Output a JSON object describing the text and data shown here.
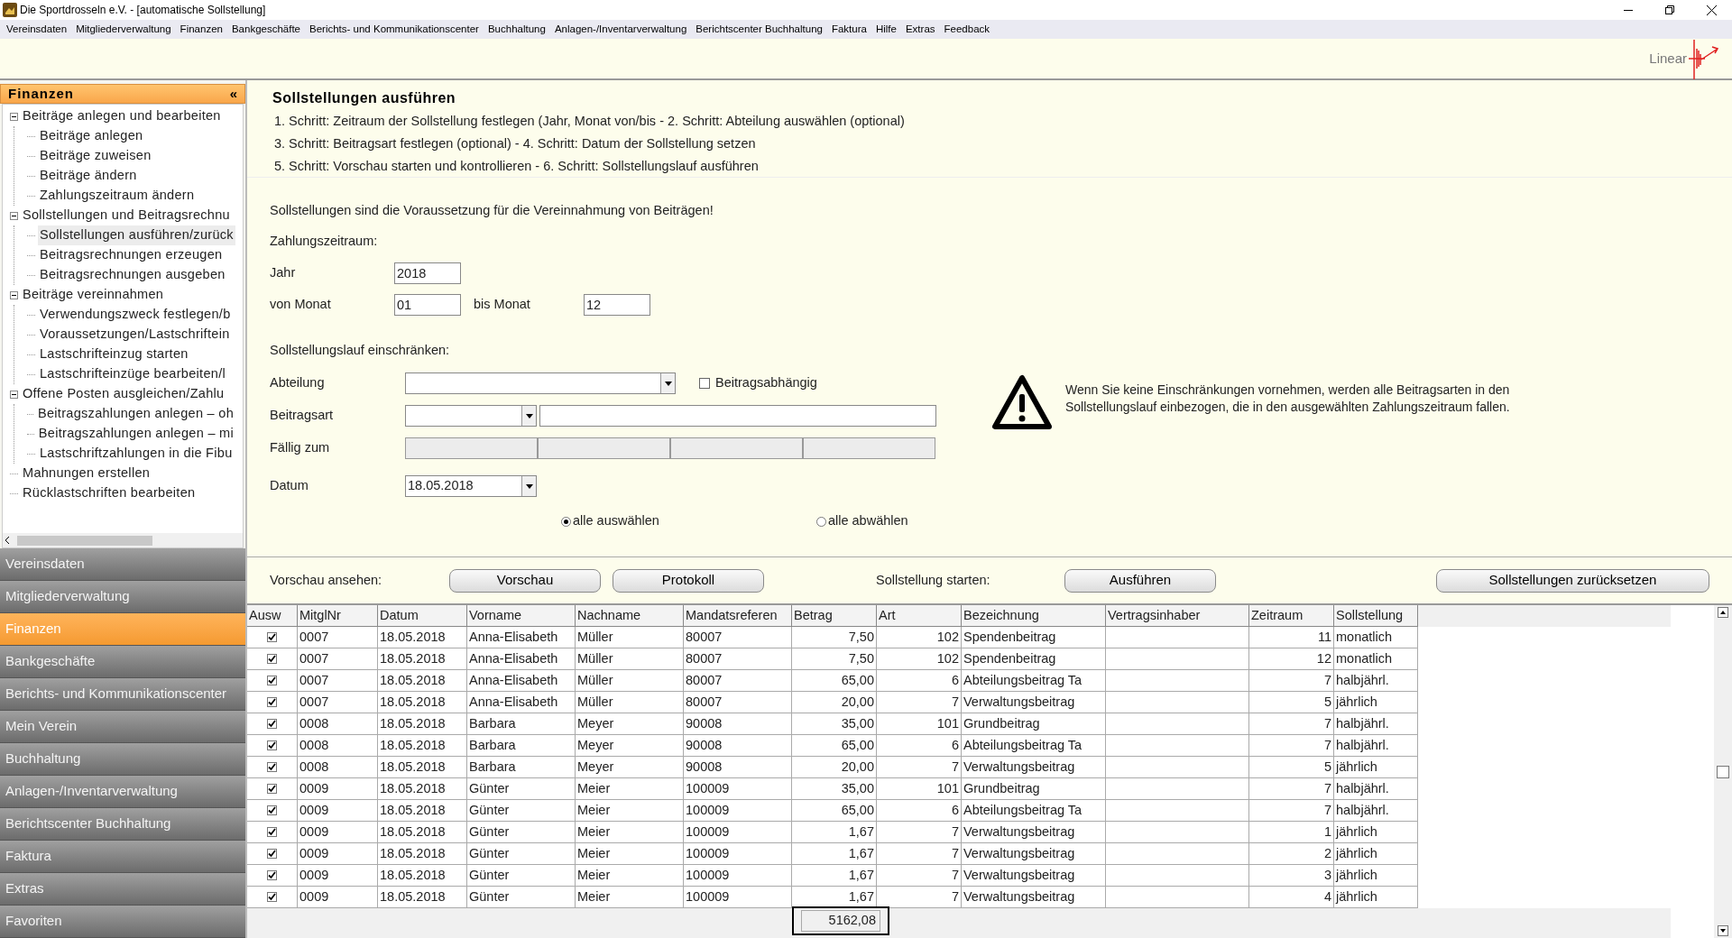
{
  "window": {
    "title": "Die Sportdrosseln e.V. - [automatische Sollstellung]"
  },
  "menu": [
    "Vereinsdaten",
    "Mitgliederverwaltung",
    "Finanzen",
    "Bankgeschäfte",
    "Berichts- und Kommunikationscenter",
    "Buchhaltung",
    "Anlagen-/Inventarverwaltung",
    "Berichtscenter Buchhaltung",
    "Faktura",
    "Hilfe",
    "Extras",
    "Feedback"
  ],
  "logo": {
    "text": "Linear"
  },
  "sidebar": {
    "title": "Finanzen",
    "collapse": "«",
    "tree": [
      {
        "label": "Beiträge anlegen und bearbeiten",
        "expanded": true,
        "children": [
          {
            "label": "Beiträge anlegen",
            "selected": false
          },
          {
            "label": "Beiträge zuweisen",
            "selected": false
          },
          {
            "label": "Beiträge ändern",
            "selected": false
          },
          {
            "label": "Zahlungszeitraum ändern",
            "selected": false
          }
        ]
      },
      {
        "label": "Sollstellungen und Beitragsrechnu",
        "expanded": true,
        "children": [
          {
            "label": "Sollstellungen ausführen/zurück",
            "selected": true
          },
          {
            "label": "Beitragsrechnungen erzeugen",
            "selected": false
          },
          {
            "label": "Beitragsrechnungen ausgeben",
            "selected": false
          }
        ]
      },
      {
        "label": "Beiträge vereinnahmen",
        "expanded": true,
        "children": [
          {
            "label": "Verwendungszweck festlegen/b",
            "selected": false
          },
          {
            "label": "Voraussetzungen/Lastschriftein",
            "selected": false
          },
          {
            "label": "Lastschrifteinzug starten",
            "selected": false
          },
          {
            "label": "Lastschrifteinzüge bearbeiten/l",
            "selected": false
          }
        ]
      },
      {
        "label": "Offene Posten ausgleichen/Zahlu",
        "expanded": true,
        "children": [
          {
            "label": "Beitragszahlungen anlegen – oh",
            "selected": false
          },
          {
            "label": "Beitragszahlungen anlegen – mi",
            "selected": false
          },
          {
            "label": "Lastschriftzahlungen in die Fibu",
            "selected": false
          }
        ]
      },
      {
        "label": "Mahnungen erstellen",
        "selected": false
      },
      {
        "label": "Rücklastschriften bearbeiten",
        "selected": false
      }
    ],
    "nav": [
      {
        "label": "Vereinsdaten",
        "selected": false
      },
      {
        "label": "Mitgliederverwaltung",
        "selected": false
      },
      {
        "label": "Finanzen",
        "selected": true
      },
      {
        "label": "Bankgeschäfte",
        "selected": false
      },
      {
        "label": "Berichts- und Kommunikationscenter",
        "selected": false
      },
      {
        "label": "Mein Verein",
        "selected": false
      },
      {
        "label": "Buchhaltung",
        "selected": false
      },
      {
        "label": "Anlagen-/Inventarverwaltung",
        "selected": false
      },
      {
        "label": "Berichtscenter Buchhaltung",
        "selected": false
      },
      {
        "label": "Faktura",
        "selected": false
      },
      {
        "label": "Extras",
        "selected": false
      },
      {
        "label": "Favoriten",
        "selected": false
      }
    ]
  },
  "steps": {
    "title": "Sollstellungen ausführen",
    "lines": [
      "1. Schritt: Zeitraum der Sollstellung festlegen (Jahr, Monat von/bis - 2. Schritt: Abteilung auswählen (optional)",
      "3. Schritt: Beitragsart festlegen (optional) - 4. Schritt: Datum der Sollstellung setzen",
      "5. Schritt: Vorschau starten und kontrollieren - 6. Schritt: Sollstellungslauf ausführen"
    ]
  },
  "form": {
    "intro": "Sollstellungen sind die Voraussetzung für die Vereinnahmung von Beiträgen!",
    "period_heading": "Zahlungszeitraum:",
    "year_label": "Jahr",
    "year": "2018",
    "from_label": "von Monat",
    "from": "01",
    "to_label": "bis Monat",
    "to": "12",
    "restrict_heading": "Sollstellungslauf einschränken:",
    "department_label": "Abteilung",
    "dependent": {
      "label": "Beitragsabhängig",
      "checked": false
    },
    "type_label": "Beitragsart",
    "due_label": "Fällig zum",
    "date_label": "Datum",
    "date": "18.05.2018",
    "warning": "Wenn Sie keine Einschränkungen vornehmen, werden alle Beitragsarten in den Sollstellungslauf einbezogen, die in den ausgewählten Zahlungszeitraum fallen.",
    "radios": [
      {
        "label": "alle auswählen",
        "selected": true
      },
      {
        "label": "alle abwählen",
        "selected": false
      }
    ]
  },
  "actions": {
    "preview_label": "Vorschau ansehen:",
    "preview": "Vorschau",
    "log": "Protokoll",
    "start_label": "Sollstellung starten:",
    "run": "Ausführen",
    "reset": "Sollstellungen zurücksetzen"
  },
  "table": {
    "columns": [
      "Ausw",
      "MitglNr",
      "Datum",
      "Vorname",
      "Nachname",
      "Mandatsreferen",
      "Betrag",
      "Art",
      "Bezeichnung",
      "Vertragsinhaber",
      "Zeitraum",
      "Sollstellung"
    ],
    "rows": [
      {
        "checked": true,
        "mitglnr": "0007",
        "datum": "18.05.2018",
        "vorname": "Anna-Elisabeth",
        "nachname": "Müller",
        "mandat": "80007",
        "betrag": "7,50",
        "art": "102",
        "bezeichnung": "Spendenbeitrag",
        "zeitraum": "11",
        "sollstellung": "monatlich"
      },
      {
        "checked": true,
        "mitglnr": "0007",
        "datum": "18.05.2018",
        "vorname": "Anna-Elisabeth",
        "nachname": "Müller",
        "mandat": "80007",
        "betrag": "7,50",
        "art": "102",
        "bezeichnung": "Spendenbeitrag",
        "zeitraum": "12",
        "sollstellung": "monatlich"
      },
      {
        "checked": true,
        "mitglnr": "0007",
        "datum": "18.05.2018",
        "vorname": "Anna-Elisabeth",
        "nachname": "Müller",
        "mandat": "80007",
        "betrag": "65,00",
        "art": "6",
        "bezeichnung": "Abteilungsbeitrag Ta",
        "zeitraum": "7",
        "sollstellung": "halbjährl."
      },
      {
        "checked": true,
        "mitglnr": "0007",
        "datum": "18.05.2018",
        "vorname": "Anna-Elisabeth",
        "nachname": "Müller",
        "mandat": "80007",
        "betrag": "20,00",
        "art": "7",
        "bezeichnung": "Verwaltungsbeitrag",
        "zeitraum": "5",
        "sollstellung": "jährlich"
      },
      {
        "checked": true,
        "mitglnr": "0008",
        "datum": "18.05.2018",
        "vorname": "Barbara",
        "nachname": "Meyer",
        "mandat": "90008",
        "betrag": "35,00",
        "art": "101",
        "bezeichnung": "Grundbeitrag",
        "zeitraum": "7",
        "sollstellung": "halbjährl."
      },
      {
        "checked": true,
        "mitglnr": "0008",
        "datum": "18.05.2018",
        "vorname": "Barbara",
        "nachname": "Meyer",
        "mandat": "90008",
        "betrag": "65,00",
        "art": "6",
        "bezeichnung": "Abteilungsbeitrag Ta",
        "zeitraum": "7",
        "sollstellung": "halbjährl."
      },
      {
        "checked": true,
        "mitglnr": "0008",
        "datum": "18.05.2018",
        "vorname": "Barbara",
        "nachname": "Meyer",
        "mandat": "90008",
        "betrag": "20,00",
        "art": "7",
        "bezeichnung": "Verwaltungsbeitrag",
        "zeitraum": "5",
        "sollstellung": "jährlich"
      },
      {
        "checked": true,
        "mitglnr": "0009",
        "datum": "18.05.2018",
        "vorname": "Günter",
        "nachname": "Meier",
        "mandat": "100009",
        "betrag": "35,00",
        "art": "101",
        "bezeichnung": "Grundbeitrag",
        "zeitraum": "7",
        "sollstellung": "halbjährl."
      },
      {
        "checked": true,
        "mitglnr": "0009",
        "datum": "18.05.2018",
        "vorname": "Günter",
        "nachname": "Meier",
        "mandat": "100009",
        "betrag": "65,00",
        "art": "6",
        "bezeichnung": "Abteilungsbeitrag Ta",
        "zeitraum": "7",
        "sollstellung": "halbjährl."
      },
      {
        "checked": true,
        "mitglnr": "0009",
        "datum": "18.05.2018",
        "vorname": "Günter",
        "nachname": "Meier",
        "mandat": "100009",
        "betrag": "1,67",
        "art": "7",
        "bezeichnung": "Verwaltungsbeitrag",
        "zeitraum": "1",
        "sollstellung": "jährlich"
      },
      {
        "checked": true,
        "mitglnr": "0009",
        "datum": "18.05.2018",
        "vorname": "Günter",
        "nachname": "Meier",
        "mandat": "100009",
        "betrag": "1,67",
        "art": "7",
        "bezeichnung": "Verwaltungsbeitrag",
        "zeitraum": "2",
        "sollstellung": "jährlich"
      },
      {
        "checked": true,
        "mitglnr": "0009",
        "datum": "18.05.2018",
        "vorname": "Günter",
        "nachname": "Meier",
        "mandat": "100009",
        "betrag": "1,67",
        "art": "7",
        "bezeichnung": "Verwaltungsbeitrag",
        "zeitraum": "3",
        "sollstellung": "jährlich"
      },
      {
        "checked": true,
        "mitglnr": "0009",
        "datum": "18.05.2018",
        "vorname": "Günter",
        "nachname": "Meier",
        "mandat": "100009",
        "betrag": "1,67",
        "art": "7",
        "bezeichnung": "Verwaltungsbeitrag",
        "zeitraum": "4",
        "sollstellung": "jährlich"
      }
    ],
    "total": "5162,08"
  }
}
